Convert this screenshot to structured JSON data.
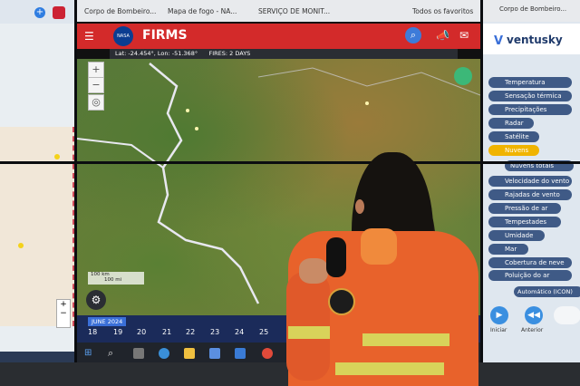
{
  "browser": {
    "tabs": [
      "Corpo de Bombeiro...",
      "Mapa de fogo - NA...",
      "SERVIÇO DE MONIT...",
      "Todos os favoritos"
    ],
    "app_title": "FIRMS",
    "nasa_label": "NASA",
    "coords": "Lat: -24.454°, Lon: -51.368°",
    "fires": "FIRES: 2 DAYS",
    "scale_top": "100 km",
    "scale_bottom": "100 mi",
    "timeline_month": "JUNE 2024",
    "timeline_days": [
      "18",
      "19",
      "20",
      "21",
      "22",
      "23",
      "24",
      "25"
    ]
  },
  "ventusky": {
    "tab": "Corpo de Bombeiro...",
    "logo": "ventusky",
    "menu": [
      {
        "label": "Temperatura",
        "active": false
      },
      {
        "label": "Sensação térmica",
        "active": false
      },
      {
        "label": "Precipitações",
        "active": false
      },
      {
        "label": "Radar",
        "active": false
      },
      {
        "label": "Satélite",
        "active": false
      },
      {
        "label": "Nuvens",
        "active": true
      },
      {
        "label": "Nuvens totais",
        "active": false
      },
      {
        "label": "Velocidade do vento",
        "active": false
      },
      {
        "label": "Rajadas de vento",
        "active": false
      },
      {
        "label": "Pressão de ar",
        "active": false
      },
      {
        "label": "Tempestades",
        "active": false
      },
      {
        "label": "Umidade",
        "active": false
      },
      {
        "label": "Mar",
        "active": false
      },
      {
        "label": "Cobertura de neve",
        "active": false
      },
      {
        "label": "Poluição do ar",
        "active": false
      }
    ],
    "model": "Automático (ICON)",
    "btn_start": "Iniciar",
    "btn_prev": "Anterior"
  },
  "colors": {
    "firms_red": "#d32a2a",
    "jacket_orange": "#e8622b",
    "ventusky_active": "#f0b400"
  }
}
